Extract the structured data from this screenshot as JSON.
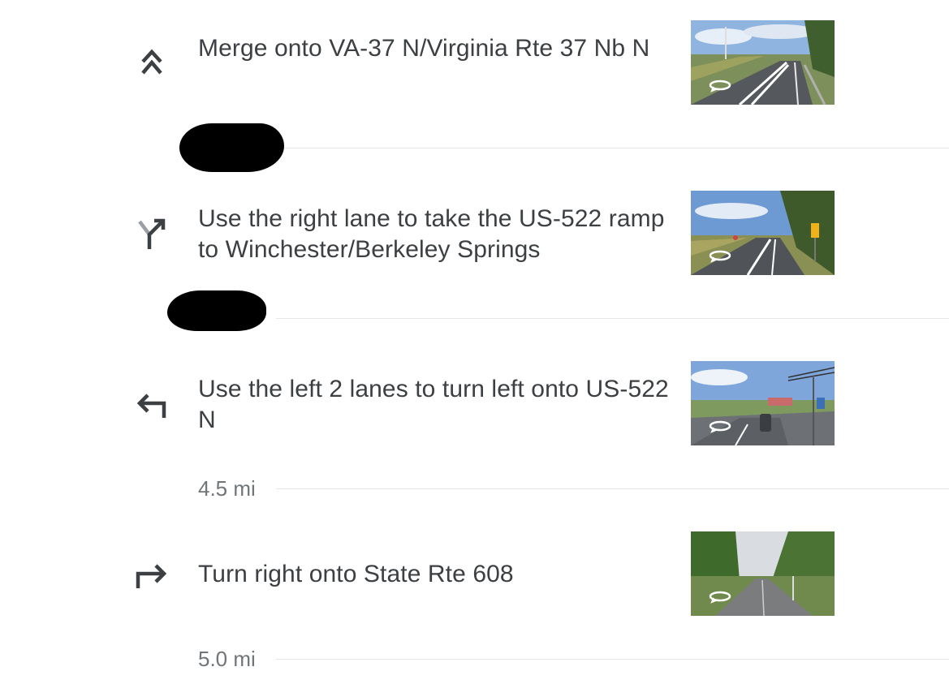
{
  "steps": [
    {
      "icon": "merge-icon",
      "instruction": "Merge onto VA-37 N/Virginia Rte 37 Nb N",
      "thumbnail": "street-view-thumbnail-highway-merge",
      "distance": ""
    },
    {
      "icon": "fork-right-icon",
      "instruction": "Use the right lane to take the US-522 ramp to Winchester/Berkeley Springs",
      "thumbnail": "street-view-thumbnail-ramp",
      "distance": ""
    },
    {
      "icon": "turn-left-icon",
      "instruction": "Use the left 2 lanes to turn left onto US-522 N",
      "thumbnail": "street-view-thumbnail-intersection",
      "distance": "4.5 mi"
    },
    {
      "icon": "turn-right-icon",
      "instruction": "Turn right onto State Rte 608",
      "thumbnail": "street-view-thumbnail-rural-road",
      "distance": "5.0 mi"
    }
  ],
  "colors": {
    "text": "#3c4043",
    "secondary_text": "#70757a",
    "divider": "#e6e6e6",
    "icon": "#3c4043",
    "icon_dim": "#9aa0a6"
  }
}
